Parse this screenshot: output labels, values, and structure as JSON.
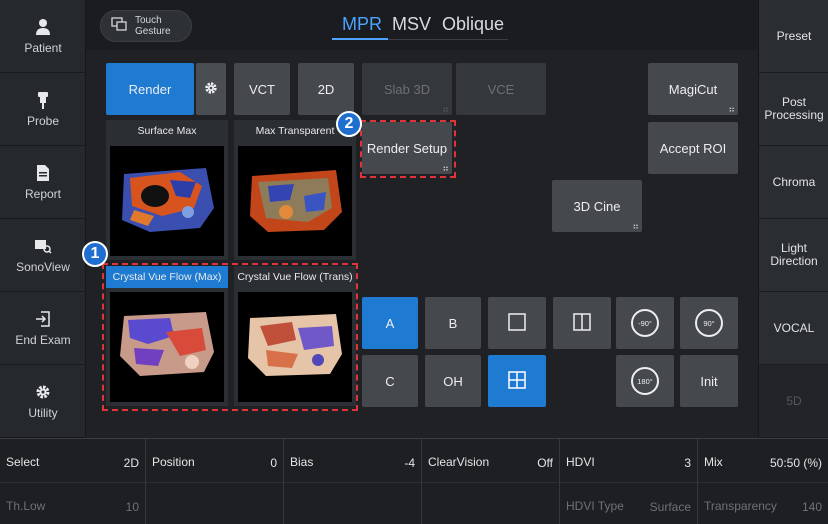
{
  "sidebar": {
    "items": [
      {
        "label": "Patient",
        "icon": "person-icon"
      },
      {
        "label": "Probe",
        "icon": "probe-icon"
      },
      {
        "label": "Report",
        "icon": "report-icon"
      },
      {
        "label": "SonoView",
        "icon": "sonoview-icon"
      },
      {
        "label": "End Exam",
        "icon": "end-exam-icon"
      },
      {
        "label": "Utility",
        "icon": "gear-icon"
      }
    ]
  },
  "topbar": {
    "touch_gesture_line1": "Touch",
    "touch_gesture_line2": "Gesture",
    "tabs": [
      "MPR",
      "MSV",
      "Oblique"
    ]
  },
  "buttons": {
    "render": "Render",
    "vct": "VCT",
    "two_d": "2D",
    "slab3d": "Slab 3D",
    "vce": "VCE",
    "magicut": "MagiCut",
    "accept_roi": "Accept ROI",
    "render_setup": "Render Setup",
    "cine3d": "3D Cine",
    "a": "A",
    "b": "B",
    "c": "C",
    "oh": "OH",
    "init": "Init",
    "rot_minus90": "-90°",
    "rot_plus90": "90°",
    "rot_180": "180°"
  },
  "thumbnails": [
    {
      "caption": "Surface Max",
      "selected": false
    },
    {
      "caption": "Max Transparent",
      "selected": false
    },
    {
      "caption": "Crystal Vue Flow (Max)",
      "selected": true
    },
    {
      "caption": "Crystal Vue Flow (Trans)",
      "selected": false
    }
  ],
  "callouts": {
    "one": "1",
    "two": "2"
  },
  "right_panel": {
    "items": [
      "Preset",
      "Post Processing",
      "Chroma",
      "Light Direction",
      "VOCAL",
      "5D"
    ]
  },
  "bottom": {
    "row1": [
      {
        "key": "Select",
        "value": "2D"
      },
      {
        "key": "Position",
        "value": "0"
      },
      {
        "key": "Bias",
        "value": "-4"
      },
      {
        "key": "ClearVision",
        "value": "Off"
      },
      {
        "key": "HDVI",
        "value": "3"
      },
      {
        "key": "Mix",
        "value": "50:50 (%)"
      }
    ],
    "row2": [
      {
        "key": "Th.Low",
        "value": "10"
      },
      {
        "key": "",
        "value": ""
      },
      {
        "key": "",
        "value": ""
      },
      {
        "key": "",
        "value": ""
      },
      {
        "key": "HDVI Type",
        "value": "Surface"
      },
      {
        "key": "Transparency",
        "value": "140"
      }
    ]
  },
  "colors": {
    "accent": "#1f7ad1",
    "callout": "#e0343a",
    "tab_active": "#4da3ff"
  }
}
